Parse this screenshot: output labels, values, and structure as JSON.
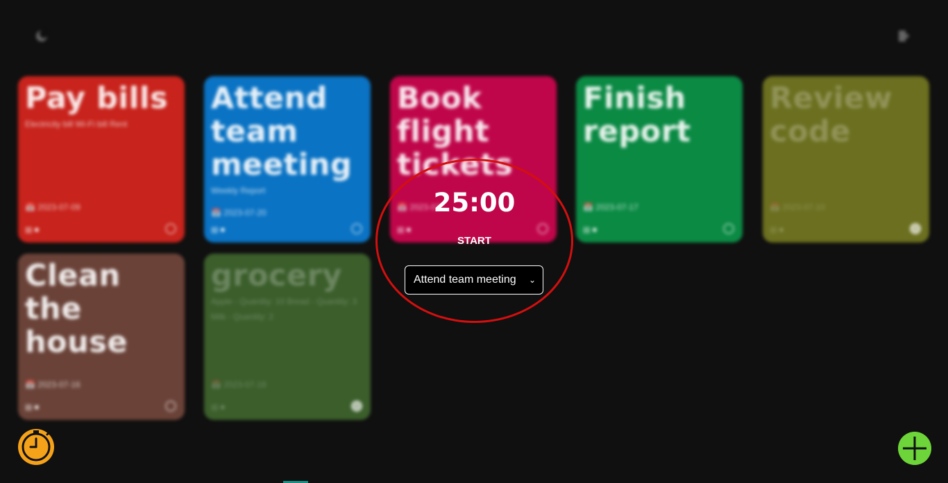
{
  "timer": {
    "time": "25:00",
    "start_label": "START",
    "selected_task": "Attend team meeting"
  },
  "cards": [
    {
      "title": "Pay bills",
      "description": "Electricity bill  Wi-Fi bill  Rent",
      "date": "2023-07-09",
      "color": "#c8231c"
    },
    {
      "title": "Attend team meeting",
      "description": "Weekly Report",
      "date": "2023-07-20",
      "color": "#0a73c4"
    },
    {
      "title": "Book flight tickets",
      "description": "",
      "date": "2023-07-",
      "color": "#c0064a"
    },
    {
      "title": "Finish report",
      "description": "",
      "date": "2023-07-17",
      "color": "#0b8a44"
    },
    {
      "title": "Review code",
      "description": "",
      "date": "2023-07-10",
      "color": "#6b6f1f"
    },
    {
      "title": "Clean the house",
      "description": "",
      "date": "2023-07-16",
      "color": "#6a4238"
    },
    {
      "title": "grocery",
      "description": "Apple - Quantity: 10  Bread - Quantity: 3  Milk - Quantity: 2",
      "date": "2023-07-18",
      "color": "#3b5e2b"
    }
  ],
  "colors": {
    "background": "#101010",
    "timer_ring": "#d40f0f",
    "timer_fab": "#f5a21b",
    "add_fab": "#6dd43a"
  },
  "icons": {
    "top_left": "moon-icon",
    "top_right": "logout-icon",
    "timer_fab": "stopwatch-icon",
    "add_fab": "plus-icon"
  }
}
